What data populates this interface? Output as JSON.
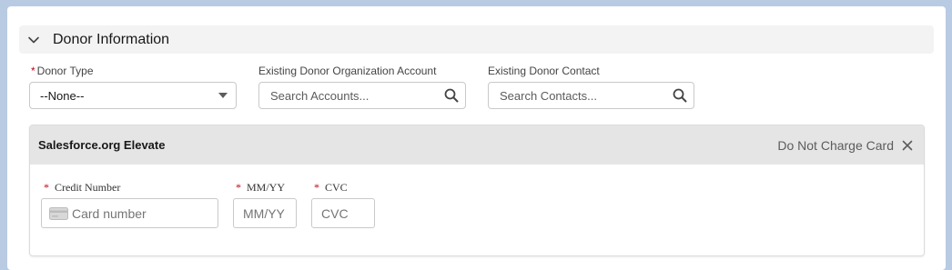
{
  "section": {
    "title": "Donor Information",
    "icon": "chevron-down-icon"
  },
  "fields": {
    "donor_type": {
      "label": "Donor Type",
      "required_mark": "*",
      "value": "--None--"
    },
    "org_account": {
      "label": "Existing Donor Organization Account",
      "placeholder": "Search Accounts..."
    },
    "donor_contact": {
      "label": "Existing Donor Contact",
      "placeholder": "Search Contacts..."
    }
  },
  "elevate": {
    "title": "Salesforce.org Elevate",
    "do_not_charge_label": "Do Not Charge Card",
    "close_icon": "close-icon",
    "credit_number": {
      "label": "Credit Number",
      "required_mark": "*",
      "placeholder": "Card number"
    },
    "expiry": {
      "label": "MM/YY",
      "required_mark": "*",
      "placeholder": "MM/YY"
    },
    "cvc": {
      "label": "CVC",
      "required_mark": "*",
      "placeholder": "CVC"
    }
  },
  "colors": {
    "page_background": "#b9cbe2",
    "required": "#ba0517",
    "section_header": "#f3f3f3",
    "elevate_header": "#e5e5e5"
  }
}
